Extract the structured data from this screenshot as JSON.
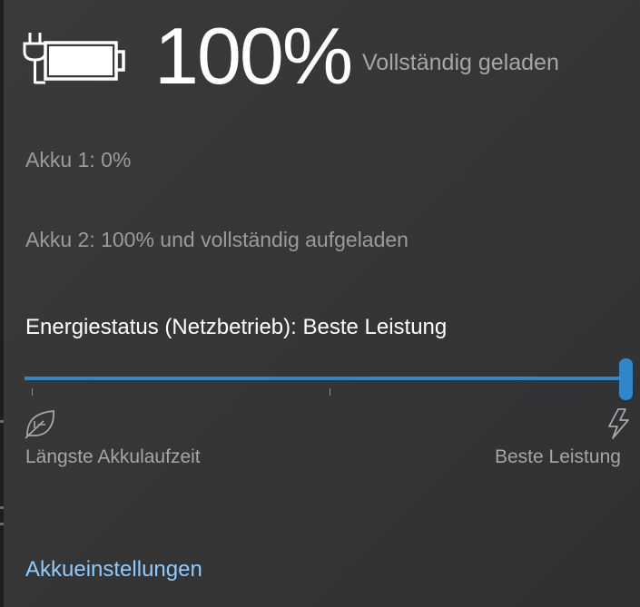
{
  "battery": {
    "percent_text": "100%",
    "status_text": "Vollständig geladen"
  },
  "akkus": [
    {
      "text": "Akku 1: 0%"
    },
    {
      "text": "Akku 2: 100% und vollständig aufgeladen"
    }
  ],
  "power_mode": {
    "label": "Energiestatus (Netzbetrieb): Beste Leistung",
    "slider_value_fraction": 1.0,
    "min_label": "Längste Akkulaufzeit",
    "max_label": "Beste Leistung",
    "min_icon": "leaf-icon",
    "max_icon": "lightning-bolt-icon"
  },
  "settings_link": {
    "label": "Akkueinstellungen"
  },
  "colors": {
    "background": "#3a3a3a",
    "accent": "#2f86c8",
    "link": "#8ecbff",
    "secondary_text": "#a6a6a6"
  }
}
